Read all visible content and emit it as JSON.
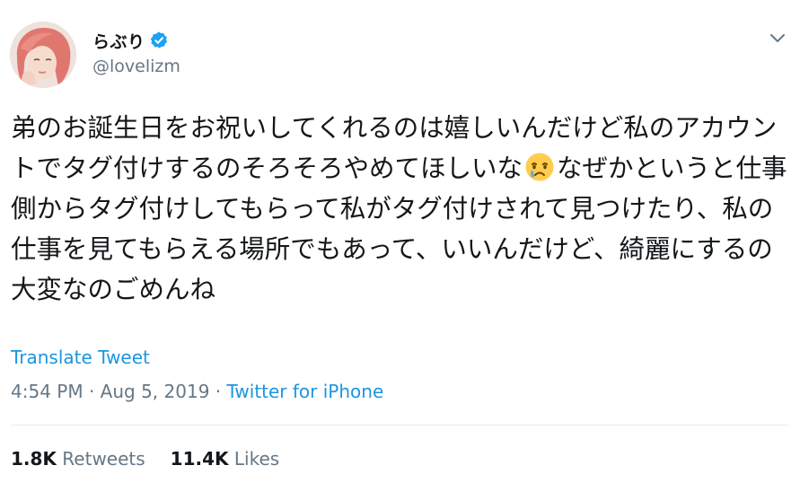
{
  "user": {
    "display_name": "らぶり",
    "handle": "@lovelizm",
    "verified_color": "#1da1f2"
  },
  "tweet": {
    "text_before_emoji": "弟のお誕生日をお祝いしてくれるのは嬉しいんだけど私のアカウントでタグ付けするのそろそろやめてほしいな",
    "emoji_name": "crying-face-icon",
    "text_after_emoji": "なぜかというと仕事側からタグ付けしてもらって私がタグ付けされて見つけたり、私の仕事を見てもらえる場所でもあって、いいんだけど、綺麗にするの大変なのごめんね",
    "translate_label": "Translate Tweet",
    "time": "4:54 PM",
    "date": "Aug 5, 2019",
    "source": "Twitter for iPhone",
    "separator": " · "
  },
  "stats": {
    "retweets_count": "1.8K",
    "retweets_label": "Retweets",
    "likes_count": "11.4K",
    "likes_label": "Likes"
  },
  "colors": {
    "link": "#1b95e0",
    "secondary_text": "#657786",
    "primary_text": "#14171a"
  }
}
